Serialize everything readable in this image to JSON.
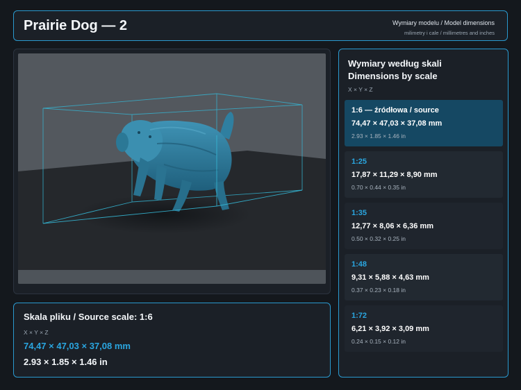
{
  "header": {
    "title": "Prairie Dog — 2",
    "subtitle": "Wymiary modelu / Model dimensions",
    "units_note": "milimetry i cale / millimetres and inches"
  },
  "viewer": {
    "model_color": "#2f7fa0",
    "bbox_color": "#35b8d6"
  },
  "source": {
    "heading": "Skala pliku / Source scale: 1:6",
    "axes": "X × Y × Z",
    "mm": "74,47 × 47,03 × 37,08 mm",
    "inches": "2.93 × 1.85 × 1.46 in"
  },
  "scales_panel": {
    "title_line1": "Wymiary według skali",
    "title_line2": "Dimensions by scale",
    "axes": "X × Y × Z",
    "items": [
      {
        "label": "1:6  —  źródłowa / source",
        "mm": "74,47 × 47,03 × 37,08 mm",
        "inches": "2.93 × 1.85 × 1.46 in",
        "selected": true
      },
      {
        "label": "1:25",
        "mm": "17,87 × 11,29 × 8,90 mm",
        "inches": "0.70 × 0.44 × 0.35 in",
        "selected": false
      },
      {
        "label": "1:35",
        "mm": "12,77 × 8,06 × 6,36 mm",
        "inches": "0.50 × 0.32 × 0.25 in",
        "selected": false
      },
      {
        "label": "1:48",
        "mm": "9,31 × 5,88 × 4,63 mm",
        "inches": "0.37 × 0.23 × 0.18 in",
        "selected": false
      },
      {
        "label": "1:72",
        "mm": "6,21 × 3,92 × 3,09 mm",
        "inches": "0.24 × 0.15 × 0.12 in",
        "selected": false
      }
    ]
  },
  "colors": {
    "accent": "#2aa6e0",
    "selected_bg": "#154863",
    "panel_bg": "#1b2027"
  }
}
